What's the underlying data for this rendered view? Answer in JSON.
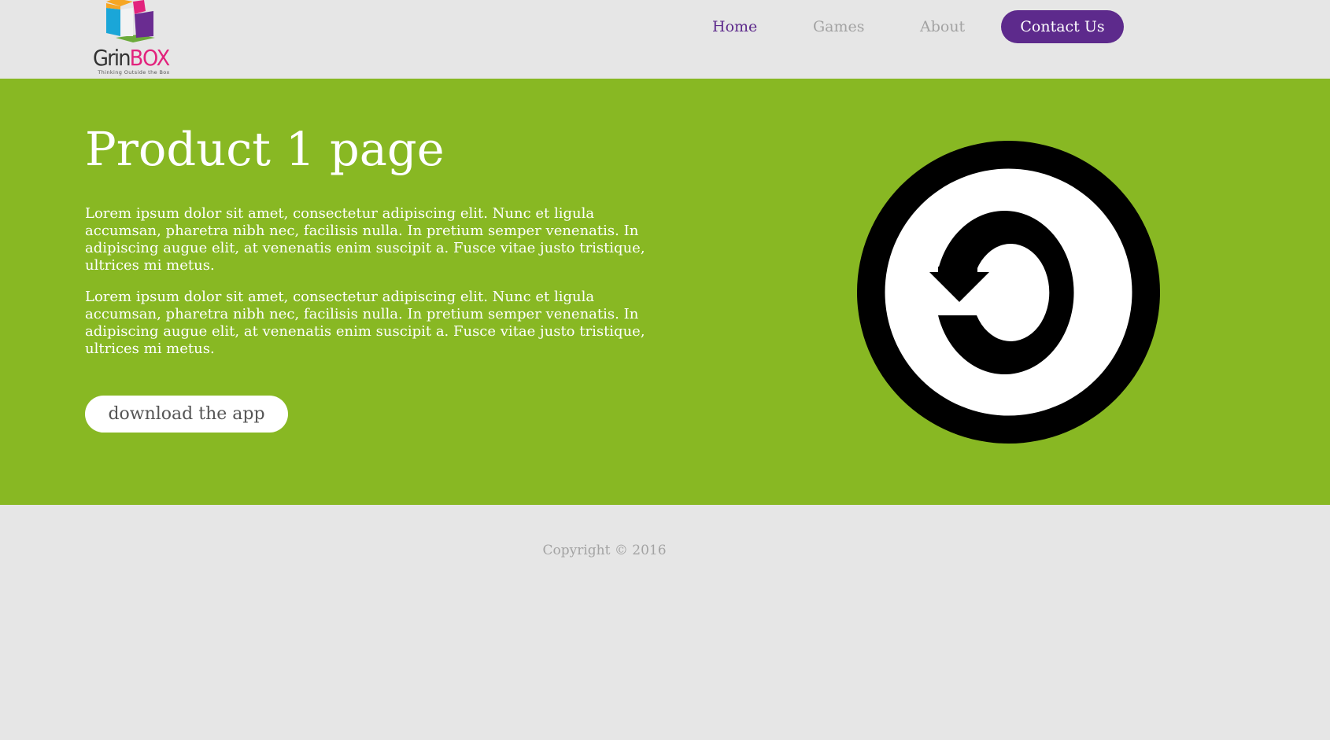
{
  "header": {
    "logo": {
      "brand_prefix": "Grin",
      "brand_suffix": "BOX",
      "tagline": "Thinking Outside the Box",
      "colors": {
        "cube_top": "#f6a623",
        "cube_left": "#1aa6d8",
        "cube_pink": "#e2237d",
        "cube_purple": "#6a2c91",
        "cube_green": "#6cab3b"
      }
    },
    "nav": {
      "items": [
        {
          "label": "Home",
          "active": true
        },
        {
          "label": "Games",
          "active": false
        },
        {
          "label": "About",
          "active": false
        },
        {
          "label": "Contact Us",
          "active": false
        }
      ]
    }
  },
  "hero": {
    "title": "Product 1 page",
    "paragraphs": [
      "Lorem ipsum dolor sit amet, consectetur adipiscing elit. Nunc et ligula accumsan, pharetra nibh nec, facilisis nulla. In pretium semper venenatis. In adipiscing augue elit, at venenatis enim suscipit a. Fusce vitae justo tristique, ultrices mi metus.",
      "Lorem ipsum dolor sit amet, consectetur adipiscing elit. Nunc et ligula accumsan, pharetra nibh nec, facilisis nulla. In pretium semper venenatis. In adipiscing augue elit, at venenatis enim suscipit a. Fusce vitae justo tristique, ultrices mi metus."
    ],
    "download_label": "download the app",
    "icon": "copyleft-icon"
  },
  "footer": {
    "copyright": "Copyright © 2016"
  },
  "colors": {
    "background": "#e6e6e6",
    "hero_green": "#88b823",
    "brand_purple": "#5d2a8c",
    "nav_inactive": "#a3a3a3",
    "white": "#ffffff"
  }
}
